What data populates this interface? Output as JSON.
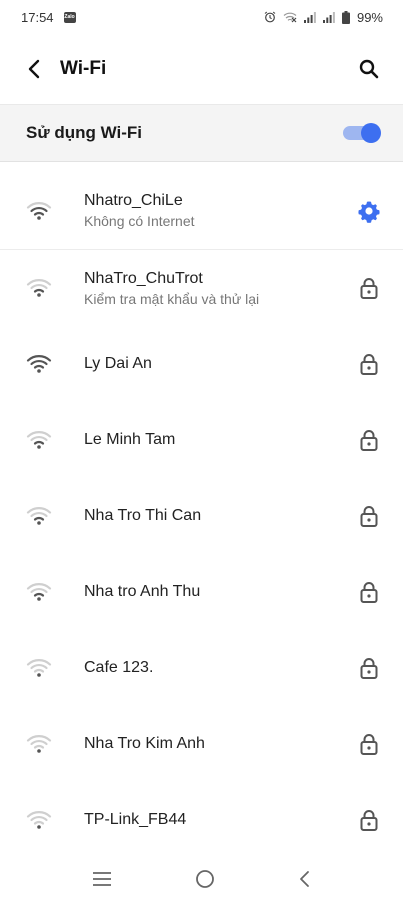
{
  "status_bar": {
    "time": "17:54",
    "notification_icon": "zalo-icon",
    "zalo_text": "Zalo",
    "icons": [
      "alarm-icon",
      "wifi-off-icon",
      "signal-icon",
      "signal-icon",
      "battery-icon"
    ],
    "battery": "99%"
  },
  "app_bar": {
    "back_icon": "back-arrow-icon",
    "title": "Wi-Fi",
    "search_icon": "search-icon"
  },
  "wifi_toggle": {
    "label": "Sử dụng Wi-Fi",
    "enabled": true,
    "accent_color": "#3d6ff0"
  },
  "networks": [
    {
      "name": "Nhatro_ChiLe",
      "status": "Không có Internet",
      "trailing_icon": "gear-icon",
      "signal_level": 3
    },
    {
      "name": "NhaTro_ChuTrot",
      "status": "Kiểm tra mật khẩu và thử lại",
      "trailing_icon": "lock-icon",
      "signal_level": 2
    },
    {
      "name": "Ly Dai An",
      "status": "",
      "trailing_icon": "lock-icon",
      "signal_level": 4
    },
    {
      "name": "Le Minh Tam",
      "status": "",
      "trailing_icon": "lock-icon",
      "signal_level": 2
    },
    {
      "name": "Nha Tro Thi Can",
      "status": "",
      "trailing_icon": "lock-icon",
      "signal_level": 2
    },
    {
      "name": "Nha tro Anh Thu",
      "status": "",
      "trailing_icon": "lock-icon",
      "signal_level": 2
    },
    {
      "name": "Cafe 123.",
      "status": "",
      "trailing_icon": "lock-icon",
      "signal_level": 1
    },
    {
      "name": "Nha Tro Kim Anh",
      "status": "",
      "trailing_icon": "lock-icon",
      "signal_level": 1
    },
    {
      "name": "TP-Link_FB44",
      "status": "",
      "trailing_icon": "lock-icon",
      "signal_level": 1
    }
  ],
  "nav_bar": {
    "icons": [
      "menu-icon",
      "home-icon",
      "back-icon"
    ]
  }
}
